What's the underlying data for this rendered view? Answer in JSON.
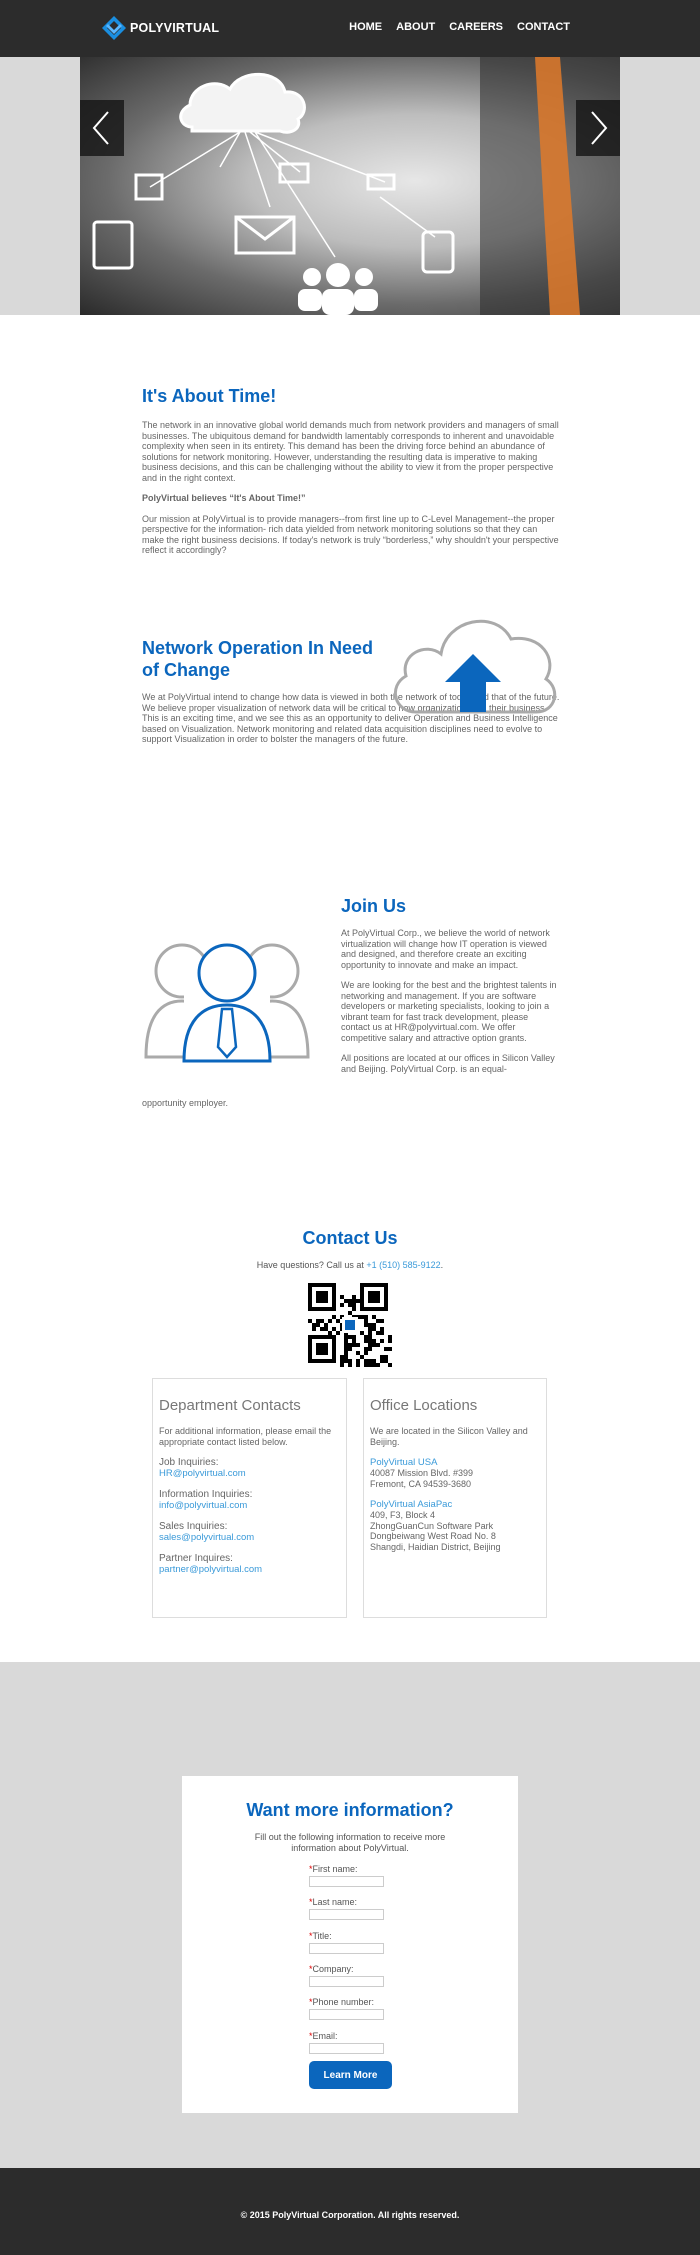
{
  "header": {
    "brand": "POLYVIRTUAL",
    "nav": [
      "HOME",
      "ABOUT",
      "CAREERS",
      "CONTACT"
    ]
  },
  "about": {
    "title": "It's About Time!",
    "p1": "The network in an innovative global world demands much from network providers and managers of small businesses. The ubiquitous demand for bandwidth lamentably corresponds to inherent and unavoidable complexity when seen in its entirety. This demand has been the driving force behind an abundance of solutions for network monitoring. However, understanding the resulting data is imperative to making business decisions, and this can be challenging without the ability to view it from the proper perspective and in the right context.",
    "p2": "PolyVirtual believes “It's About Time!”",
    "p3": "Our mission at PolyVirtual is to provide managers--from first line up to C-Level Management--the proper perspective for the information- rich data yielded from network monitoring solutions so that they can make the right business decisions. If today's network is truly “borderless,” why shouldn't your perspective reflect it accordingly?"
  },
  "network": {
    "title": "Network Operation In Need of Change",
    "p1": "We at PolyVirtual intend to change how data is viewed in both the network of today and that of the future. We believe proper visualization of network data will be critical to how organizations run their business. This is an exciting time, and we see this as an opportunity to deliver Operation and Business Intelligence based on Visualization. Network monitoring and related data acquisition disciplines need to evolve to support Visualization in order to bolster the managers of the future."
  },
  "join": {
    "title": "Join Us",
    "p1": "At PolyVirtual Corp., we believe the world of network virtualization will change how IT operation is viewed and designed, and therefore create an exciting opportunity to innovate and make an impact.",
    "p2": "We are looking for the best and the brightest talents in networking and management. If you are software developers or marketing specialists, looking to join a vibrant team for fast track development, please contact us at HR@polyvirtual.com. We offer competitive salary and attractive option grants.",
    "p3a": "All positions are located at our offices in Silicon Valley and Beijing. PolyVirtual Corp. is an equal-",
    "p3b": "opportunity employer."
  },
  "contact": {
    "title": "Contact Us",
    "call_prefix": "Have questions? Call us at ",
    "phone": "+1 (510) 585-9122",
    "call_suffix": ".",
    "dept": {
      "title": "Department Contacts",
      "intro": "For additional information, please email the appropriate contact listed below.",
      "items": [
        {
          "label": "Job Inquiries:",
          "email": "HR@polyvirtual.com"
        },
        {
          "label": "Information Inquiries:",
          "email": "info@polyvirtual.com"
        },
        {
          "label": "Sales Inquiries:",
          "email": "sales@polyvirtual.com"
        },
        {
          "label": "Partner Inquires:",
          "email": "partner@polyvirtual.com"
        }
      ]
    },
    "office": {
      "title": "Office Locations",
      "intro": "We are located in the Silicon Valley and Beijing.",
      "usa_name": "PolyVirtual USA",
      "usa_l1": "40087 Mission Blvd. #399",
      "usa_l2": "Fremont, CA 94539-3680",
      "ap_name": "PolyVirtual AsiaPac",
      "ap_l1": "409, F3, Block 4",
      "ap_l2": "ZhongGuanCun Software Park",
      "ap_l3": "Dongbeiwang West Road No. 8",
      "ap_l4": "Shangdi, Haidian District, Beijing"
    }
  },
  "form": {
    "title": "Want more information?",
    "desc": "Fill out the following information to receive more information about PolyVirtual.",
    "fields": [
      "First name:",
      "Last name:",
      "Title:",
      "Company:",
      "Phone number:",
      "Email:"
    ],
    "required_mark": "*",
    "submit": "Learn More"
  },
  "footer": {
    "copyright": "© 2015 PolyVirtual Corporation. All rights reserved."
  },
  "colors": {
    "brand_blue": "#0b66bd",
    "link_blue": "#3a9ad9",
    "dark_bar": "#2c2c2c",
    "gray_band": "#d9d9d9"
  }
}
